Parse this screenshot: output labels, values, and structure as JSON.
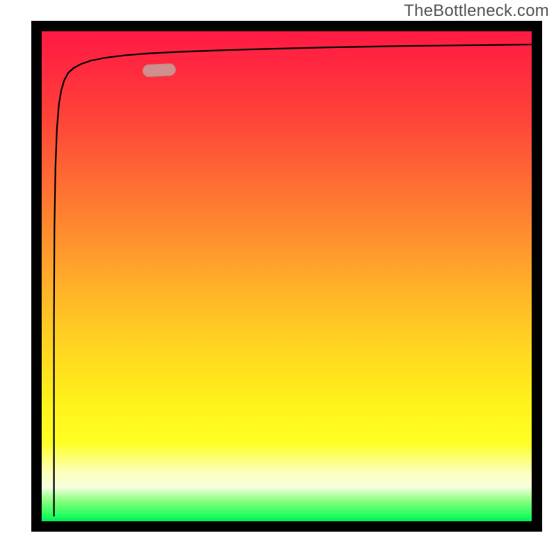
{
  "watermark": "TheBottleneck.com",
  "chart_data": {
    "type": "line",
    "title": "",
    "xlabel": "",
    "ylabel": "",
    "xlim": [
      0,
      100
    ],
    "ylim": [
      0,
      100
    ],
    "series": [
      {
        "name": "curve",
        "x": [
          2.5,
          2.5,
          2.6,
          2.8,
          3.1,
          3.5,
          4.0,
          4.6,
          5.4,
          6.5,
          8.0,
          10.0,
          13.0,
          17.0,
          22.0,
          28.0,
          36.0,
          46.0,
          58.0,
          74.0,
          92.0,
          100.0
        ],
        "y": [
          1.0,
          40.0,
          60.0,
          72.0,
          80.0,
          85.0,
          88.0,
          90.0,
          91.5,
          92.5,
          93.3,
          94.0,
          94.6,
          95.1,
          95.5,
          95.8,
          96.1,
          96.4,
          96.7,
          97.0,
          97.2,
          97.3
        ]
      }
    ],
    "annotations": [
      {
        "name": "pill-marker",
        "x": 24,
        "y": 92,
        "color": "#cf8f8c"
      }
    ],
    "background_gradient": {
      "top": "#ff1a43",
      "middle": "#ffe31e",
      "bottom": "#00e85b"
    }
  }
}
